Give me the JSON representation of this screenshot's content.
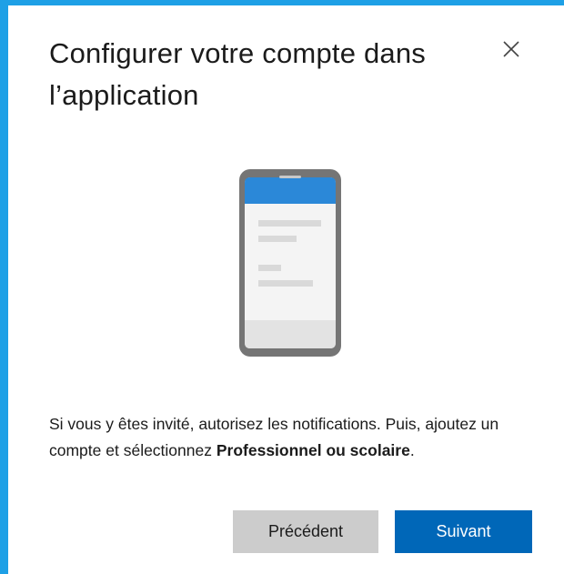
{
  "dialog": {
    "title": "Configurer votre compte dans l’application",
    "close_icon": "close-icon",
    "illustration_icon": "phone-app-icon",
    "instructions": {
      "text_before_bold": "Si vous y êtes invité, autorisez les notifications. Puis, ajoutez un compte et sélectionnez ",
      "bold_text": "Professionnel ou scolaire",
      "text_after_bold": "."
    },
    "buttons": {
      "previous_label": "Précédent",
      "next_label": "Suivant"
    }
  },
  "colors": {
    "accent": "#1ea0e6",
    "primary_button": "#0067b8",
    "secondary_button": "#cccccc",
    "phone_header": "#2b88d8",
    "phone_frame": "#757575"
  }
}
